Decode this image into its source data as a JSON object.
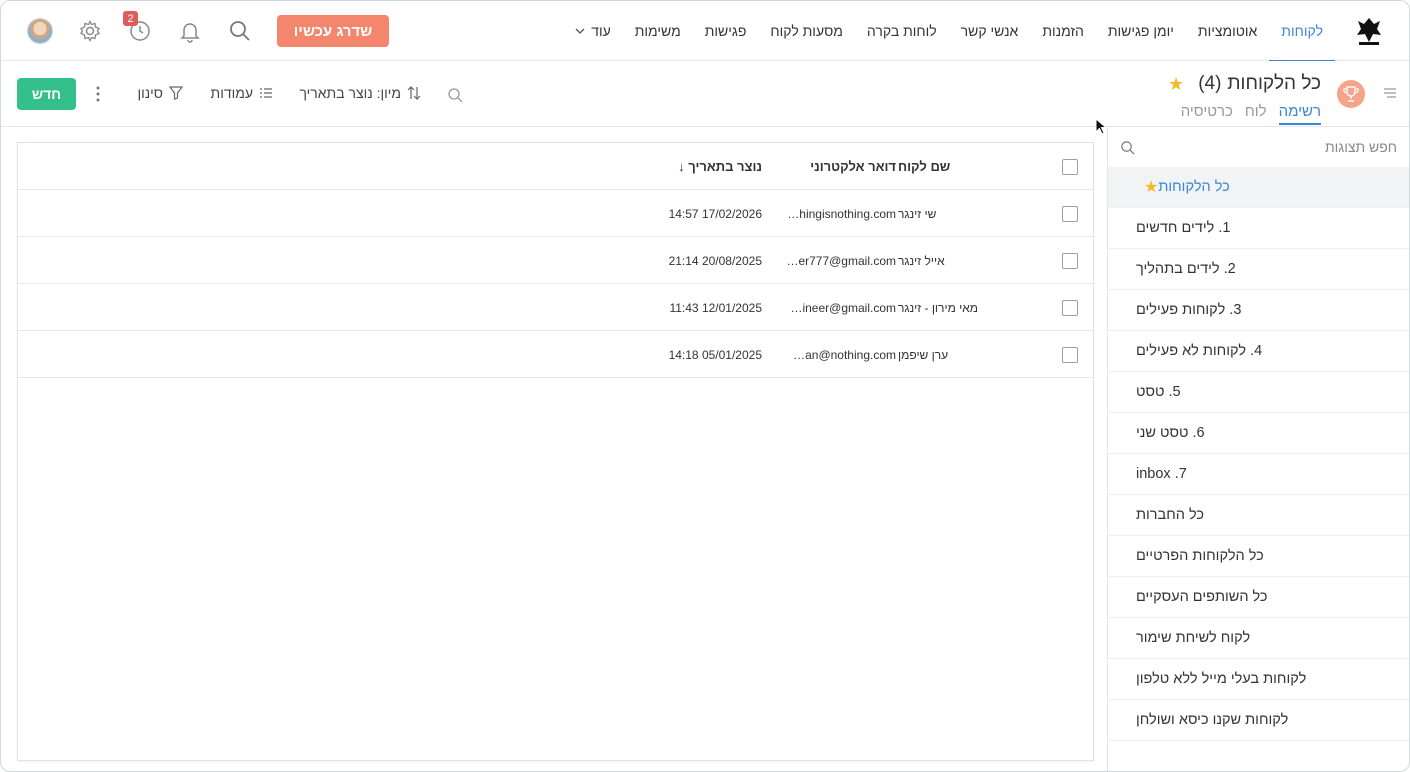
{
  "nav": {
    "items": [
      "לקוחות",
      "אוטומציות",
      "יומן פגישות",
      "הזמנות",
      "אנשי קשר",
      "לוחות בקרה",
      "מסעות לקוח",
      "פגישות",
      "משימות"
    ],
    "more_label": "עוד",
    "upgrade_label": "שדרג עכשיו",
    "notification_count": "2",
    "accent_color": "#3a86d4"
  },
  "header": {
    "title": "כל הלקוחות",
    "count": "(4)",
    "tabs": [
      "רשימה",
      "לוח",
      "כרטיסיה"
    ],
    "sort_label": "מיון: נוצר בתאריך",
    "columns_label": "עמודות",
    "filter_label": "סינון",
    "new_label": "חדש"
  },
  "sidebar": {
    "search_placeholder": "חפש תצוגות",
    "items": [
      "כל הלקוחות",
      "1. לידים חדשים",
      "2. לידים בתהליך",
      "3. לקוחות פעילים",
      "4. לקוחות לא פעילים",
      "5. טסט",
      "6. טסט שני",
      "inbox .7",
      "כל החברות",
      "כל הלקוחות הפרטיים",
      "כל השותפים העסקיים",
      "לקוח לשיחת שימור",
      "לקוחות בעלי מייל ללא טלפון",
      "לקוחות שקנו כיסא ושולחן"
    ]
  },
  "table": {
    "headers": [
      "שם לקוח",
      "דואר אלקטרוני",
      "↓ נוצר בתאריך"
    ],
    "rows": [
      {
        "name": "שי זינגר",
        "email": "…hingisnothing.com",
        "created": "14:57 17/02/2026"
      },
      {
        "name": "אייל זינגר",
        "email": "…er777@gmail.com",
        "created": "21:14 20/08/2025"
      },
      {
        "name": "מאי מירון - זינגר",
        "email": "…ineer@gmail.com",
        "created": "11:43 12/01/2025"
      },
      {
        "name": "ערן שיפמן",
        "email": "…an@nothing.com",
        "created": "14:18 05/01/2025"
      }
    ]
  },
  "colors": {
    "upgrade": "#f4866d",
    "new_button": "#33c08b",
    "star": "#f2b92a",
    "badge": "#e05c5c"
  }
}
